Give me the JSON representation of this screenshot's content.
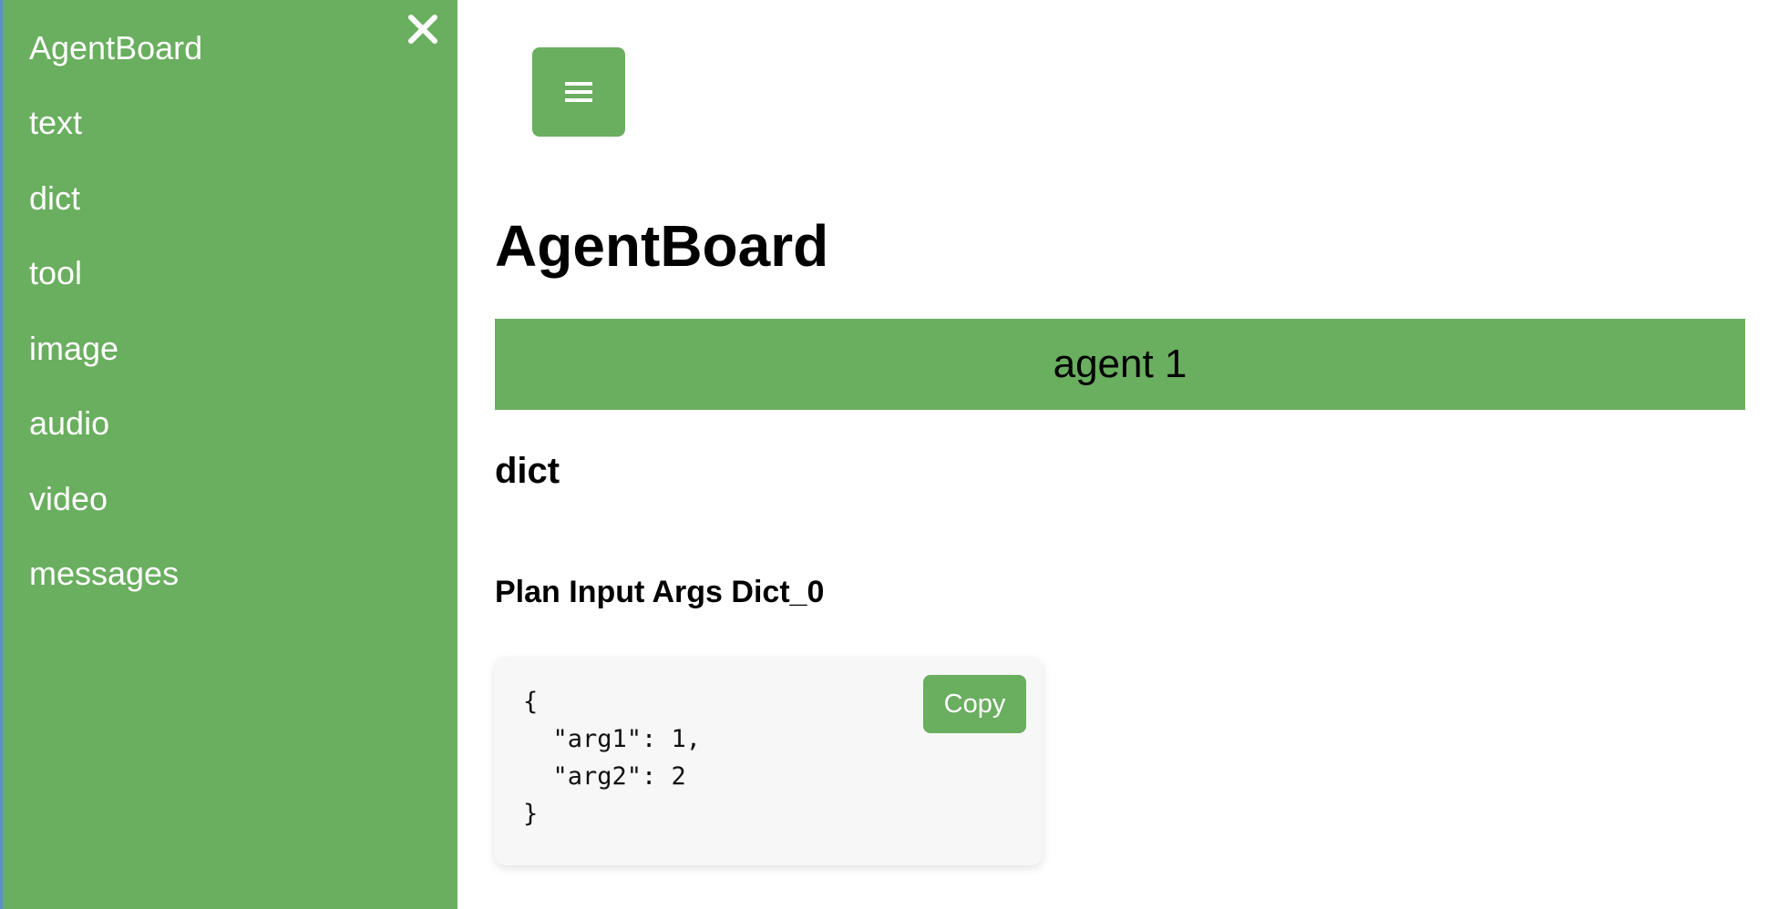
{
  "sidebar": {
    "items": [
      {
        "label": "AgentBoard"
      },
      {
        "label": "text"
      },
      {
        "label": "dict"
      },
      {
        "label": "tool"
      },
      {
        "label": "image"
      },
      {
        "label": "audio"
      },
      {
        "label": "video"
      },
      {
        "label": "messages"
      }
    ],
    "close_icon": "close-icon"
  },
  "header": {
    "menu_icon": "hamburger-menu-icon",
    "title": "AgentBoard"
  },
  "main": {
    "agent_tab": "agent 1",
    "section_title": "dict",
    "item_title": "Plan Input Args Dict_0",
    "code": "{\n  \"arg1\": 1,\n  \"arg2\": 2\n}",
    "copy_label": "Copy"
  },
  "colors": {
    "accent": "#6aae5f",
    "code_bg": "#f7f7f7",
    "text": "#000000"
  }
}
